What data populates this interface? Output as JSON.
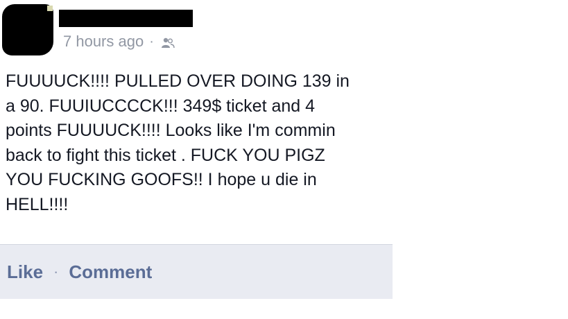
{
  "post": {
    "timestamp": "7 hours ago",
    "separator": "·",
    "audience_icon": "friends-icon",
    "lines": [
      "FUUUUCK!!!! PULLED OVER DOING 139 in",
      "a 90. FUUIUCCCCK!!! 349$ ticket and 4",
      "points FUUUUCK!!!! Looks like I'm commin",
      "back to fight this ticket . FUCK YOU PIGZ",
      "YOU FUCKING GOOFS!! I hope u die in",
      "HELL!!!!"
    ]
  },
  "actions": {
    "like_label": "Like",
    "separator": "·",
    "comment_label": "Comment"
  },
  "colors": {
    "link": "#5b6d96",
    "meta": "#9197a3",
    "action_bar_bg": "#e9ebf2"
  }
}
